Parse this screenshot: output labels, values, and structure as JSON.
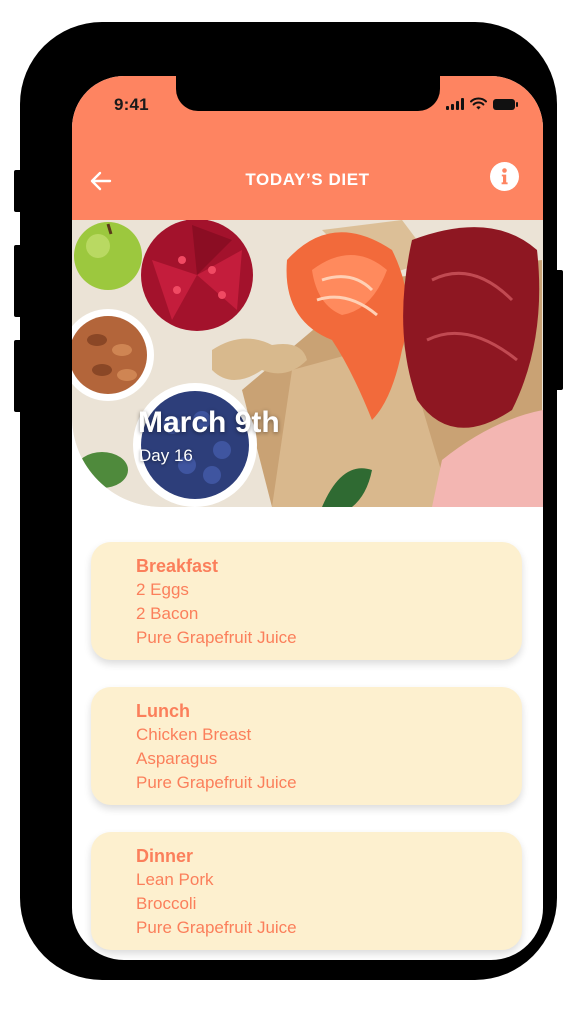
{
  "status_bar": {
    "time": "9:41"
  },
  "header": {
    "title": "TODAY’S DIET",
    "accent_color": "#fe8461",
    "back_icon": "arrow-left-icon",
    "info_icon": "info-icon"
  },
  "hero": {
    "date": "March 9th",
    "day": "Day 16"
  },
  "meals": [
    {
      "name": "Breakfast",
      "items": [
        "2 Eggs",
        "2 Bacon",
        "Pure Grapefruit Juice"
      ]
    },
    {
      "name": "Lunch",
      "items": [
        "Chicken Breast",
        "Asparagus",
        "Pure Grapefruit Juice"
      ]
    },
    {
      "name": "Dinner",
      "items": [
        "Lean Pork",
        "Broccoli",
        "Pure Grapefruit Juice"
      ]
    }
  ],
  "card_color": "#fdf0cf",
  "meal_text_color": "#fb7f5b"
}
